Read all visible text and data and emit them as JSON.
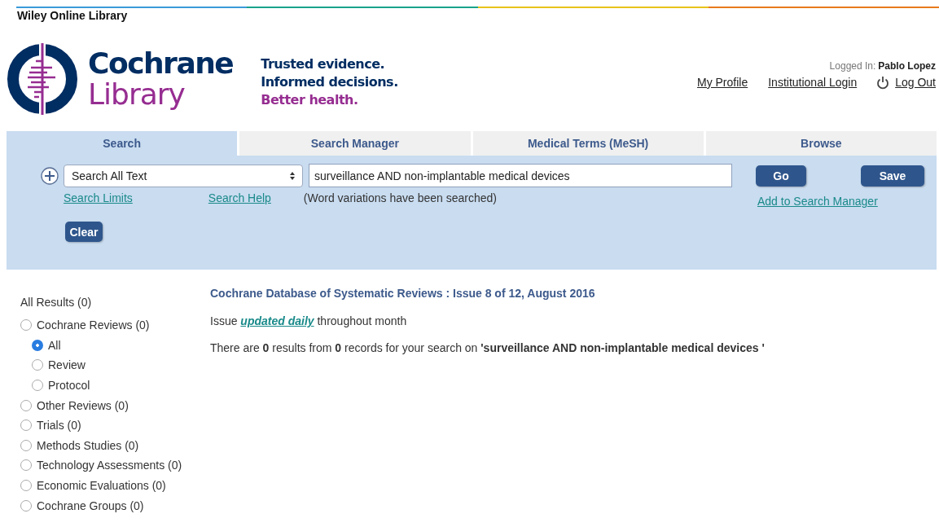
{
  "brand_bar": {
    "title": "Wiley Online Library"
  },
  "logo": {
    "line_1": "Cochrane",
    "line_2": "Library"
  },
  "tagline": [
    "Trusted evidence.",
    "Informed decisions.",
    "Better health."
  ],
  "account": {
    "label": "Logged In:",
    "user": "Pablo Lopez",
    "links": [
      {
        "label": "My Profile",
        "kind": "text"
      },
      {
        "label": "Institutional Login",
        "kind": "text"
      },
      {
        "label": "Log Out",
        "kind": "power"
      }
    ]
  },
  "tabs": [
    {
      "label": "Search",
      "selected": true
    },
    {
      "label": "Search Manager",
      "selected": false
    },
    {
      "label": "Medical Terms (MeSH)",
      "selected": false
    },
    {
      "label": "Browse",
      "selected": false
    }
  ],
  "search": {
    "field_select": "Search All Text",
    "query": "surveillance AND non-implantable medical devices",
    "go": "Go",
    "save": "Save",
    "limits_link": "Search Limits",
    "help_link": "Search Help",
    "variations_note": "(Word variations have been searched)",
    "add_link": "Add to Search Manager",
    "clear": "Clear"
  },
  "results_filter": {
    "all_results": "All Results (0)",
    "options": [
      {
        "label": "Cochrane Reviews (0)",
        "selected": false,
        "children": [
          {
            "label": "All",
            "selected": true
          },
          {
            "label": "Review",
            "selected": false
          },
          {
            "label": "Protocol",
            "selected": false
          }
        ]
      },
      {
        "label": "Other Reviews (0)",
        "selected": false
      },
      {
        "label": "Trials (0)",
        "selected": false
      },
      {
        "label": "Methods Studies (0)",
        "selected": false
      },
      {
        "label": "Technology Assessments (0)",
        "selected": false
      },
      {
        "label": "Economic Evaluations (0)",
        "selected": false
      },
      {
        "label": "Cochrane Groups (0)",
        "selected": false
      }
    ]
  },
  "results": {
    "heading": "Cochrane Database of Systematic Reviews : Issue 8 of 12, August 2016",
    "issue_note": {
      "before": "Issue",
      "link": "updated daily",
      "after": "throughout month"
    },
    "summary": "There are **0** results from **0** records for your search on **'surveillance AND non-implantable medical devices '**"
  }
}
